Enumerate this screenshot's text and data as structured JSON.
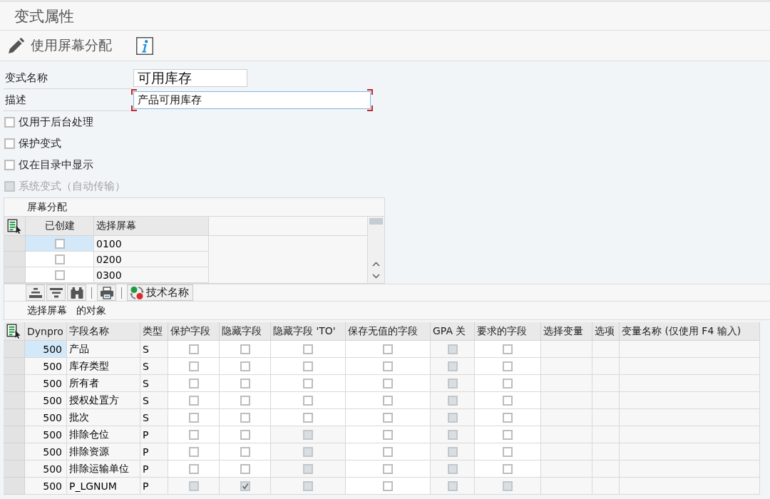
{
  "title": "变式属性",
  "toolbar": {
    "button_label": "使用屏幕分配"
  },
  "form": {
    "fields": [
      {
        "label": "变式名称",
        "value": "可用库存",
        "focused": false
      },
      {
        "label": "描述",
        "value": "产品可用库存",
        "focused": true
      }
    ],
    "checkboxes": [
      {
        "label": "仅用于后台处理",
        "checked": false,
        "disabled": false
      },
      {
        "label": "保护变式",
        "checked": false,
        "disabled": false
      },
      {
        "label": "仅在目录中显示",
        "checked": false,
        "disabled": false
      },
      {
        "label": "系统变式（自动传输）",
        "checked": false,
        "disabled": true
      }
    ]
  },
  "screen_assignment": {
    "title": "屏幕分配",
    "columns": [
      "已创建",
      "选择屏幕"
    ],
    "rows": [
      {
        "focused": true,
        "created": {
          "checked": false,
          "disabled": false
        },
        "screen": "0100"
      },
      {
        "focused": false,
        "created": {
          "checked": false,
          "disabled": false
        },
        "screen": "0200"
      },
      {
        "focused": false,
        "created": {
          "checked": false,
          "disabled": false
        },
        "screen": "0300"
      }
    ]
  },
  "table_toolbar": {
    "technical_name_button": "技术名称"
  },
  "objects_caption": "选择屏幕   的对象",
  "fields_table": {
    "columns": [
      {
        "label": "Dynpro",
        "kind": "number"
      },
      {
        "label": "字段名称",
        "kind": "text"
      },
      {
        "label": "类型",
        "kind": "text"
      },
      {
        "label": "保护字段",
        "kind": "check"
      },
      {
        "label": "隐藏字段",
        "kind": "check"
      },
      {
        "label": "隐藏字段 'TO'",
        "kind": "check"
      },
      {
        "label": "保存无值的字段",
        "kind": "check"
      },
      {
        "label": "GPA 关",
        "kind": "check"
      },
      {
        "label": "要求的字段",
        "kind": "check"
      },
      {
        "label": "选择变量",
        "kind": "blank"
      },
      {
        "label": "选项",
        "kind": "blank"
      },
      {
        "label": "变量名称 (仅使用 F4 输入)",
        "kind": "blank"
      }
    ],
    "rows": [
      {
        "focused": true,
        "texts": [
          "500",
          "产品",
          "S"
        ],
        "checks": [
          {
            "checked": false,
            "disabled": false
          },
          {
            "checked": false,
            "disabled": false
          },
          {
            "checked": false,
            "disabled": false
          },
          {
            "checked": false,
            "disabled": false
          },
          {
            "checked": false,
            "disabled": true
          },
          {
            "checked": false,
            "disabled": false
          }
        ]
      },
      {
        "focused": false,
        "texts": [
          "500",
          "库存类型",
          "S"
        ],
        "checks": [
          {
            "checked": false,
            "disabled": false
          },
          {
            "checked": false,
            "disabled": false
          },
          {
            "checked": false,
            "disabled": false
          },
          {
            "checked": false,
            "disabled": false
          },
          {
            "checked": false,
            "disabled": true
          },
          {
            "checked": false,
            "disabled": false
          }
        ]
      },
      {
        "focused": false,
        "texts": [
          "500",
          "所有者",
          "S"
        ],
        "checks": [
          {
            "checked": false,
            "disabled": false
          },
          {
            "checked": false,
            "disabled": false
          },
          {
            "checked": false,
            "disabled": false
          },
          {
            "checked": false,
            "disabled": false
          },
          {
            "checked": false,
            "disabled": true
          },
          {
            "checked": false,
            "disabled": false
          }
        ]
      },
      {
        "focused": false,
        "texts": [
          "500",
          "授权处置方",
          "S"
        ],
        "checks": [
          {
            "checked": false,
            "disabled": false
          },
          {
            "checked": false,
            "disabled": false
          },
          {
            "checked": false,
            "disabled": false
          },
          {
            "checked": false,
            "disabled": false
          },
          {
            "checked": false,
            "disabled": true
          },
          {
            "checked": false,
            "disabled": false
          }
        ]
      },
      {
        "focused": false,
        "texts": [
          "500",
          "批次",
          "S"
        ],
        "checks": [
          {
            "checked": false,
            "disabled": false
          },
          {
            "checked": false,
            "disabled": false
          },
          {
            "checked": false,
            "disabled": false
          },
          {
            "checked": false,
            "disabled": false
          },
          {
            "checked": false,
            "disabled": true
          },
          {
            "checked": false,
            "disabled": false
          }
        ]
      },
      {
        "focused": false,
        "texts": [
          "500",
          "排除仓位",
          "P"
        ],
        "checks": [
          {
            "checked": false,
            "disabled": false
          },
          {
            "checked": false,
            "disabled": false
          },
          {
            "checked": false,
            "disabled": true
          },
          {
            "checked": false,
            "disabled": false
          },
          {
            "checked": false,
            "disabled": true
          },
          {
            "checked": false,
            "disabled": false
          }
        ]
      },
      {
        "focused": false,
        "texts": [
          "500",
          "排除资源",
          "P"
        ],
        "checks": [
          {
            "checked": false,
            "disabled": false
          },
          {
            "checked": false,
            "disabled": false
          },
          {
            "checked": false,
            "disabled": true
          },
          {
            "checked": false,
            "disabled": false
          },
          {
            "checked": false,
            "disabled": true
          },
          {
            "checked": false,
            "disabled": false
          }
        ]
      },
      {
        "focused": false,
        "texts": [
          "500",
          "排除运输单位",
          "P"
        ],
        "checks": [
          {
            "checked": false,
            "disabled": false
          },
          {
            "checked": false,
            "disabled": false
          },
          {
            "checked": false,
            "disabled": true
          },
          {
            "checked": false,
            "disabled": false
          },
          {
            "checked": false,
            "disabled": true
          },
          {
            "checked": false,
            "disabled": false
          }
        ]
      },
      {
        "focused": false,
        "texts": [
          "500",
          "P_LGNUM",
          "P"
        ],
        "checks": [
          {
            "checked": false,
            "disabled": true
          },
          {
            "checked": true,
            "disabled": true
          },
          {
            "checked": false,
            "disabled": true
          },
          {
            "checked": false,
            "disabled": false
          },
          {
            "checked": false,
            "disabled": true
          },
          {
            "checked": false,
            "disabled": true
          }
        ]
      }
    ]
  }
}
